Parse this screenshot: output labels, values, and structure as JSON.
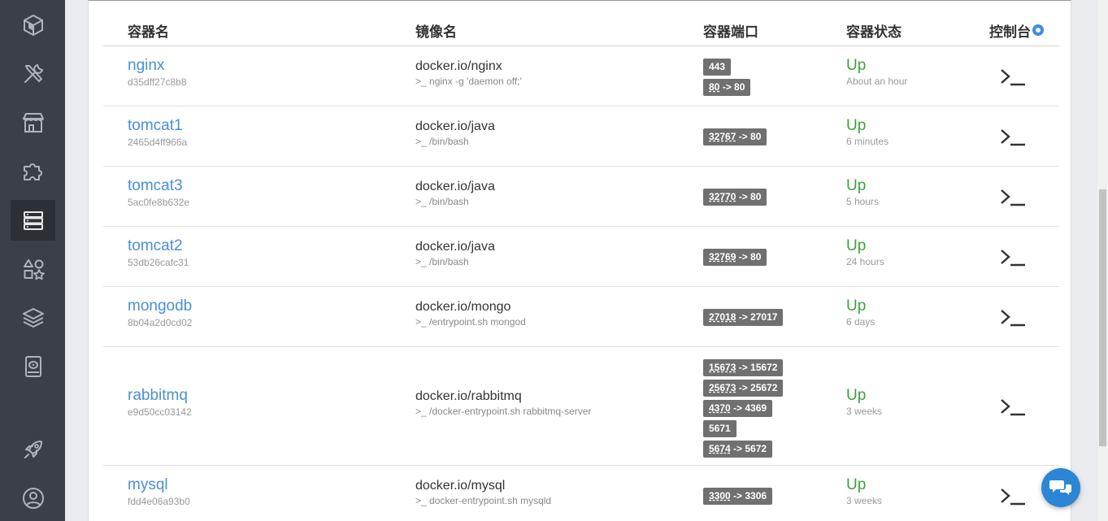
{
  "sidebar": {
    "items": [
      {
        "icon": "logo-cube-icon"
      },
      {
        "icon": "tools-icon"
      },
      {
        "icon": "store-icon"
      },
      {
        "icon": "puzzle-icon"
      },
      {
        "icon": "server-stack-icon",
        "active": true
      },
      {
        "icon": "shapes-icon"
      },
      {
        "icon": "layers-icon"
      },
      {
        "icon": "disk-icon"
      },
      {
        "icon": "rocket-icon"
      },
      {
        "icon": "user-icon"
      }
    ]
  },
  "table": {
    "headers": {
      "name": "容器名",
      "image": "镜像名",
      "ports": "容器端口",
      "status": "容器状态",
      "console": "控制台"
    },
    "rows": [
      {
        "name": "nginx",
        "id": "d35dff27c8b8",
        "image": "docker.io/nginx",
        "cmd": ">_ nginx -g 'daemon off;'",
        "ports": [
          {
            "host": "443",
            "container": ""
          },
          {
            "host": "80",
            "container": "80"
          }
        ],
        "status": "Up",
        "uptime": "About an hour"
      },
      {
        "name": "tomcat1",
        "id": "2465d4ff966a",
        "image": "docker.io/java",
        "cmd": ">_ /bin/bash",
        "ports": [
          {
            "host": "32767",
            "container": "80"
          }
        ],
        "status": "Up",
        "uptime": "6 minutes"
      },
      {
        "name": "tomcat3",
        "id": "5ac0fe8b632e",
        "image": "docker.io/java",
        "cmd": ">_ /bin/bash",
        "ports": [
          {
            "host": "32770",
            "container": "80"
          }
        ],
        "status": "Up",
        "uptime": "5 hours"
      },
      {
        "name": "tomcat2",
        "id": "53db26cafc31",
        "image": "docker.io/java",
        "cmd": ">_ /bin/bash",
        "ports": [
          {
            "host": "32769",
            "container": "80"
          }
        ],
        "status": "Up",
        "uptime": "24 hours"
      },
      {
        "name": "mongodb",
        "id": "8b04a2d0cd02",
        "image": "docker.io/mongo",
        "cmd": ">_ /entrypoint.sh mongod",
        "ports": [
          {
            "host": "27018",
            "container": "27017"
          }
        ],
        "status": "Up",
        "uptime": "6 days"
      },
      {
        "name": "rabbitmq",
        "id": "e9d50cc03142",
        "image": "docker.io/rabbitmq",
        "cmd": ">_ /docker-entrypoint.sh rabbitmq-server",
        "ports": [
          {
            "host": "15673",
            "container": "15672"
          },
          {
            "host": "25673",
            "container": "25672"
          },
          {
            "host": "4370",
            "container": "4369"
          },
          {
            "host": "5671",
            "container": ""
          },
          {
            "host": "5674",
            "container": "5672"
          }
        ],
        "status": "Up",
        "uptime": "3 weeks"
      },
      {
        "name": "mysql",
        "id": "fdd4e06a93b0",
        "image": "docker.io/mysql",
        "cmd": ">_ docker-entrypoint.sh mysqld",
        "ports": [
          {
            "host": "3300",
            "container": "3306"
          }
        ],
        "status": "Up",
        "uptime": "3 weeks"
      }
    ]
  },
  "chat": {
    "icon": "chat-bubbles-icon"
  },
  "colors": {
    "sidebar": "#3b4046",
    "link": "#4a8fd9",
    "status_up": "#3ea03e",
    "port_badge": "#707070",
    "chat": "#2b86d6"
  }
}
